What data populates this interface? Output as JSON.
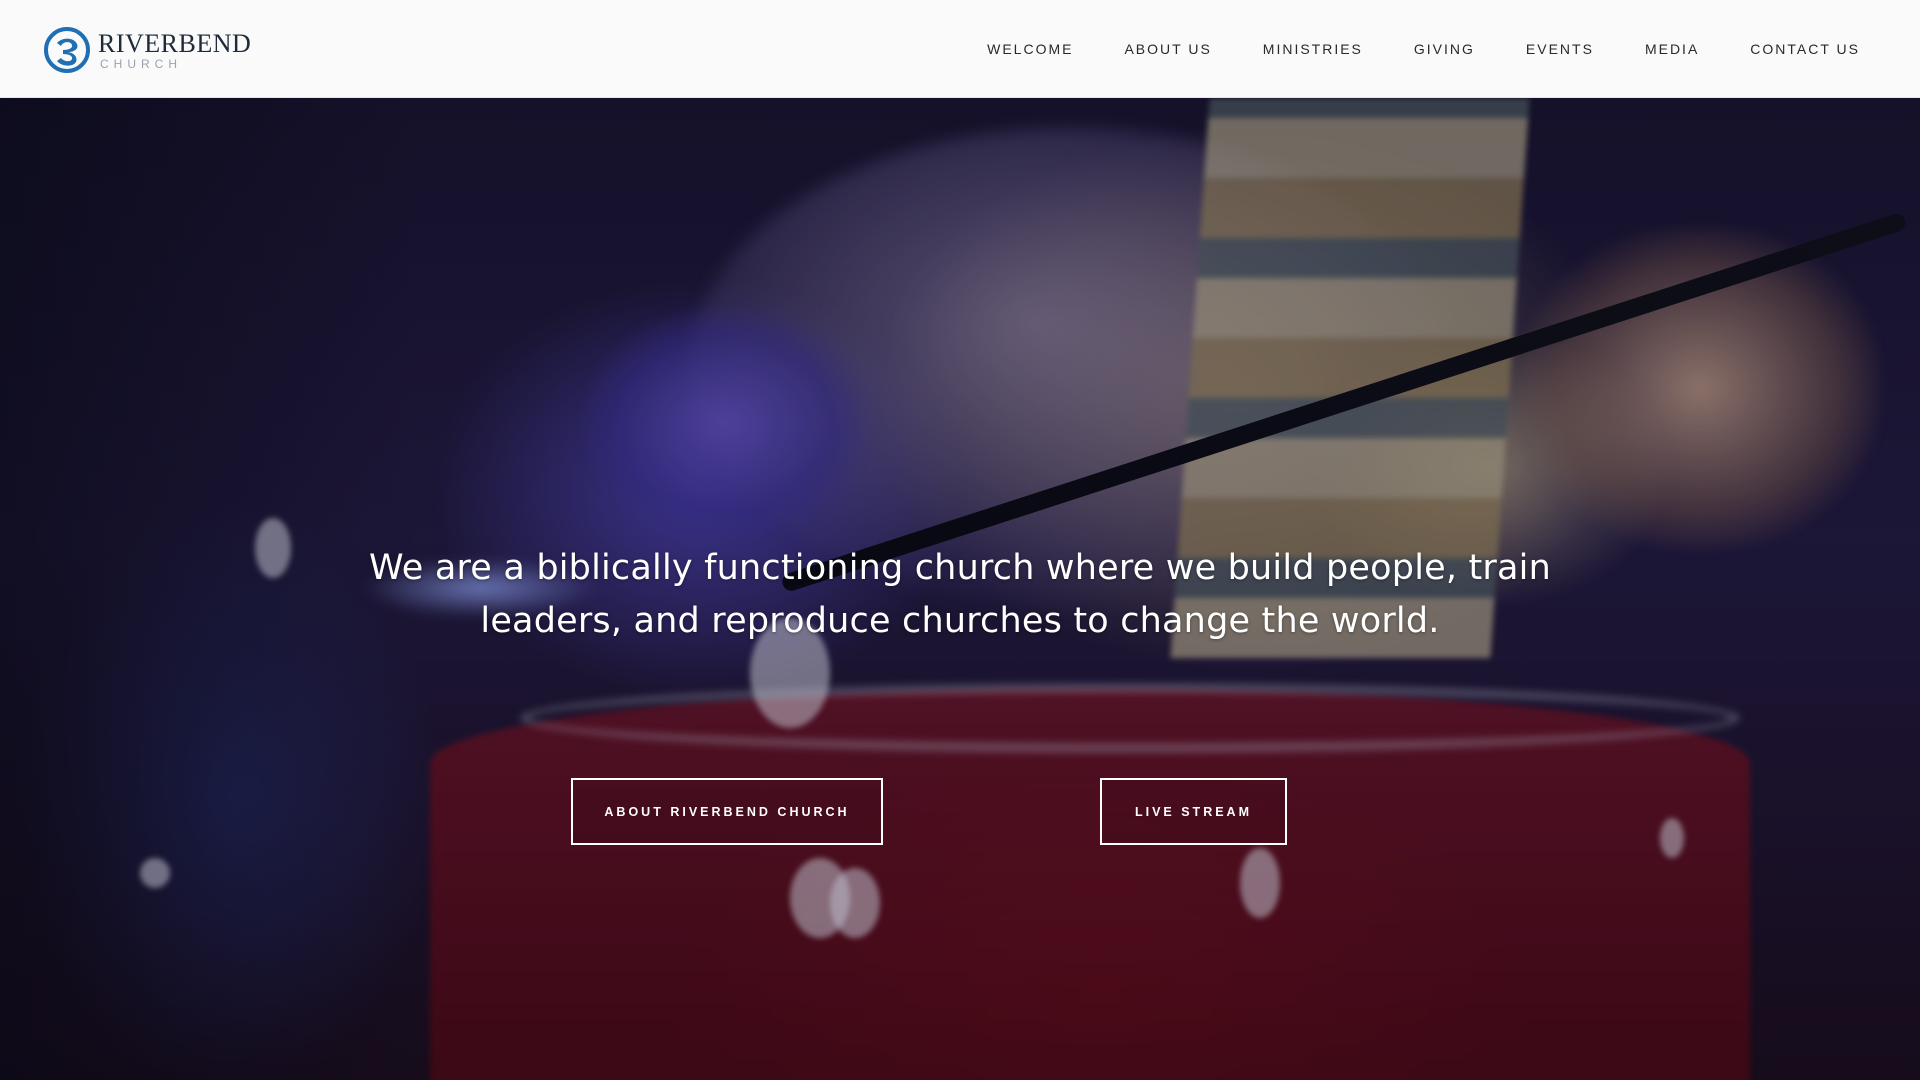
{
  "header": {
    "logo": {
      "name": "RIVERBEND",
      "subtitle": "CHURCH",
      "icon": "riverbend-logo-mark",
      "brand_color": "#1f6fb5"
    },
    "nav": [
      {
        "label": "WELCOME"
      },
      {
        "label": "ABOUT US"
      },
      {
        "label": "MINISTRIES"
      },
      {
        "label": "GIVING"
      },
      {
        "label": "EVENTS"
      },
      {
        "label": "MEDIA"
      },
      {
        "label": "CONTACT US"
      }
    ]
  },
  "hero": {
    "tagline": "We are a biblically functioning church where we build people, train leaders, and reproduce churches to change the world.",
    "buttons": {
      "about": "ABOUT RIVERBEND CHURCH",
      "live_stream": "LIVE STREAM"
    }
  }
}
